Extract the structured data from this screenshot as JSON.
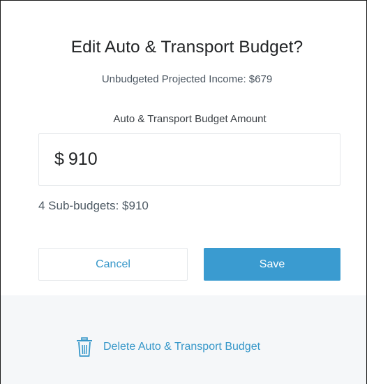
{
  "dialog": {
    "title": "Edit Auto & Transport Budget?",
    "unbudgeted_income": "Unbudgeted Projected Income: $679",
    "amount_label": "Auto & Transport Budget Amount",
    "amount_currency": "$",
    "amount_value": "910",
    "subbudgets_text": "4 Sub-budgets: $910",
    "cancel_label": "Cancel",
    "save_label": "Save",
    "delete_label": "Delete Auto & Transport Budget",
    "delete_icon": "trash-icon"
  },
  "colors": {
    "accent": "#3a9bd0",
    "link": "#3697c9",
    "footer_bg": "#f5f7f9",
    "border": "#e4e7ea",
    "title_text": "#222426"
  }
}
